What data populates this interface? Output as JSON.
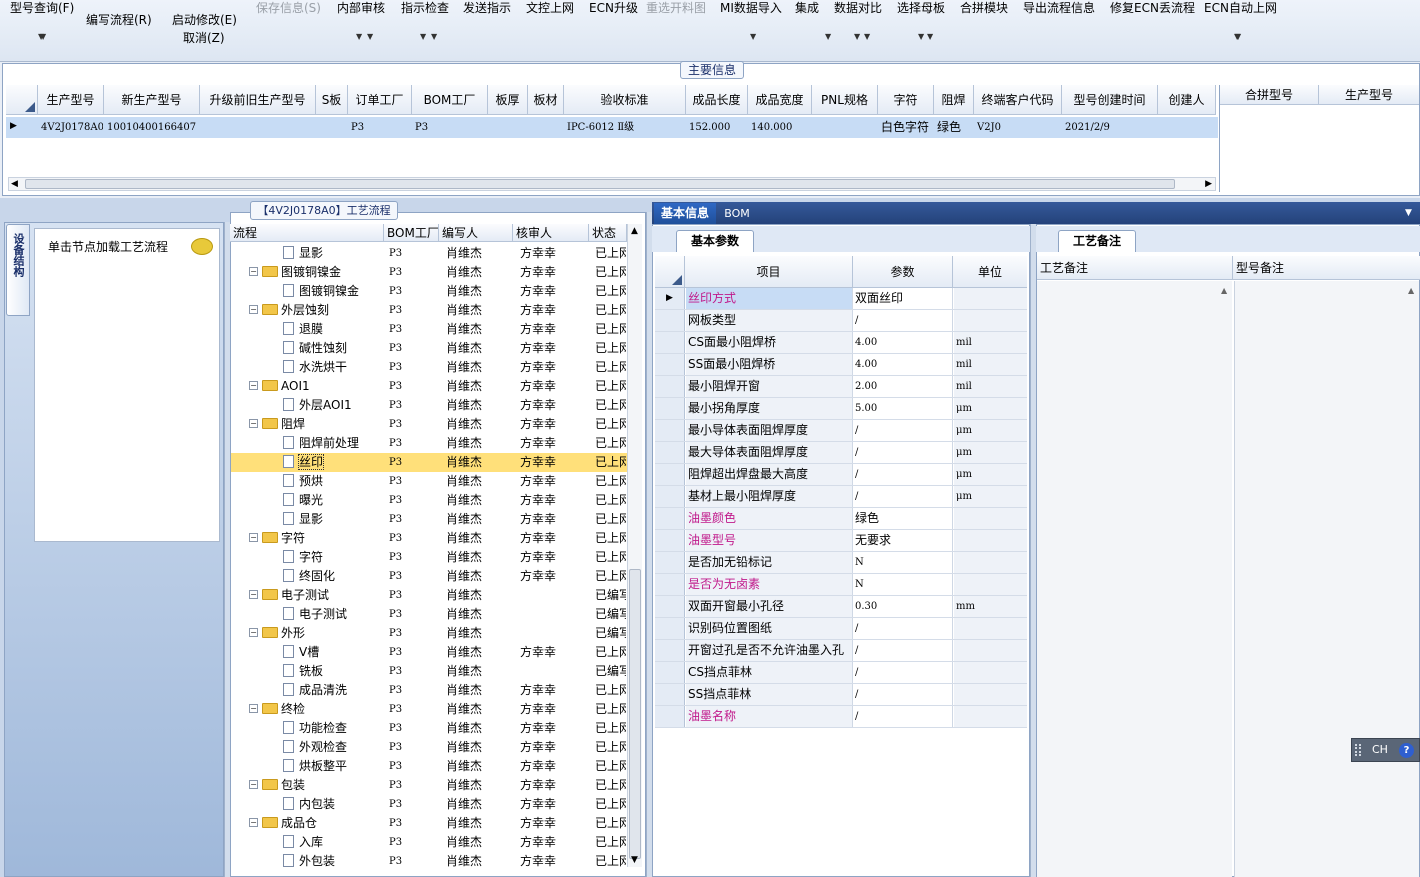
{
  "toolbar": {
    "items": [
      {
        "label": "型号查询(F)",
        "state": "enabled"
      },
      {
        "label": "编写流程(R)",
        "state": "enabled"
      },
      {
        "label": "启动修改(E)",
        "state": "enabled"
      },
      {
        "label": "取消(Z)",
        "state": "enabled"
      },
      {
        "label": "保存信息(S)",
        "state": "disabled"
      },
      {
        "label": "内部审核",
        "state": "enabled"
      },
      {
        "label": "指示检查",
        "state": "enabled"
      },
      {
        "label": "发送指示",
        "state": "enabled"
      },
      {
        "label": "文控上网",
        "state": "enabled"
      },
      {
        "label": "ECN升级",
        "state": "enabled"
      },
      {
        "label": "重选开料图",
        "state": "disabled"
      },
      {
        "label": "MI数据导入",
        "state": "enabled"
      },
      {
        "label": "集成",
        "state": "enabled"
      },
      {
        "label": "数据对比",
        "state": "enabled"
      },
      {
        "label": "选择母板",
        "state": "enabled"
      },
      {
        "label": "合拼模块",
        "state": "enabled"
      },
      {
        "label": "导出流程信息",
        "state": "enabled"
      },
      {
        "label": "修复ECN丢流程",
        "state": "enabled"
      },
      {
        "label": "ECN自动上网",
        "state": "enabled"
      }
    ],
    "dropdown_icon": "triangle-down-icon"
  },
  "main_info": {
    "title": "主要信息",
    "columns": [
      "生产型号",
      "新生产型号",
      "升级前旧生产型号",
      "S板",
      "订单工厂",
      "BOM工厂",
      "板厚",
      "板材",
      "验收标准",
      "成品长度",
      "成品宽度",
      "PNL规格",
      "字符",
      "阻焊",
      "终端客户代码",
      "型号创建时间",
      "创建人"
    ],
    "row": [
      "4V2J0178A0",
      "10010400166407",
      "",
      "",
      "P3",
      "P3",
      "",
      "",
      "IPC-6012 Ⅱ级",
      "152.000",
      "140.000",
      "",
      "白色字符",
      "绿色",
      "V2J0",
      "2021/2/9",
      ""
    ],
    "side_columns": [
      "合拼型号",
      "生产型号"
    ]
  },
  "left_panel": {
    "vertical_tab": "设备结构",
    "hint": "单击节点加载工艺流程"
  },
  "flow": {
    "title": "【4V2J0178A0】工艺流程",
    "columns": [
      "流程",
      "BOM工厂",
      "编写人",
      "核审人",
      "状态"
    ],
    "rows": [
      {
        "name": "显影",
        "folder": false,
        "bom": "P3",
        "writer": "肖维杰",
        "auditor": "方幸幸",
        "status": "已上网",
        "selected": false
      },
      {
        "name": "图镀铜镍金",
        "folder": true,
        "bom": "P3",
        "writer": "肖维杰",
        "auditor": "方幸幸",
        "status": "已上网",
        "selected": false
      },
      {
        "name": "图镀铜镍金",
        "folder": false,
        "bom": "P3",
        "writer": "肖维杰",
        "auditor": "方幸幸",
        "status": "已上网",
        "selected": false
      },
      {
        "name": "外层蚀刻",
        "folder": true,
        "bom": "P3",
        "writer": "肖维杰",
        "auditor": "方幸幸",
        "status": "已上网",
        "selected": false
      },
      {
        "name": "退膜",
        "folder": false,
        "bom": "P3",
        "writer": "肖维杰",
        "auditor": "方幸幸",
        "status": "已上网",
        "selected": false
      },
      {
        "name": "碱性蚀刻",
        "folder": false,
        "bom": "P3",
        "writer": "肖维杰",
        "auditor": "方幸幸",
        "status": "已上网",
        "selected": false
      },
      {
        "name": "水洗烘干",
        "folder": false,
        "bom": "P3",
        "writer": "肖维杰",
        "auditor": "方幸幸",
        "status": "已上网",
        "selected": false
      },
      {
        "name": "AOI1",
        "folder": true,
        "bom": "P3",
        "writer": "肖维杰",
        "auditor": "方幸幸",
        "status": "已上网",
        "selected": false
      },
      {
        "name": "外层AOI1",
        "folder": false,
        "bom": "P3",
        "writer": "肖维杰",
        "auditor": "方幸幸",
        "status": "已上网",
        "selected": false
      },
      {
        "name": "阻焊",
        "folder": true,
        "bom": "P3",
        "writer": "肖维杰",
        "auditor": "方幸幸",
        "status": "已上网",
        "selected": false
      },
      {
        "name": "阻焊前处理",
        "folder": false,
        "bom": "P3",
        "writer": "肖维杰",
        "auditor": "方幸幸",
        "status": "已上网",
        "selected": false
      },
      {
        "name": "丝印",
        "folder": false,
        "bom": "P3",
        "writer": "肖维杰",
        "auditor": "方幸幸",
        "status": "已上网",
        "selected": true
      },
      {
        "name": "预烘",
        "folder": false,
        "bom": "P3",
        "writer": "肖维杰",
        "auditor": "方幸幸",
        "status": "已上网",
        "selected": false
      },
      {
        "name": "曝光",
        "folder": false,
        "bom": "P3",
        "writer": "肖维杰",
        "auditor": "方幸幸",
        "status": "已上网",
        "selected": false
      },
      {
        "name": "显影",
        "folder": false,
        "bom": "P3",
        "writer": "肖维杰",
        "auditor": "方幸幸",
        "status": "已上网",
        "selected": false
      },
      {
        "name": "字符",
        "folder": true,
        "bom": "P3",
        "writer": "肖维杰",
        "auditor": "方幸幸",
        "status": "已上网",
        "selected": false
      },
      {
        "name": "字符",
        "folder": false,
        "bom": "P3",
        "writer": "肖维杰",
        "auditor": "方幸幸",
        "status": "已上网",
        "selected": false
      },
      {
        "name": "终固化",
        "folder": false,
        "bom": "P3",
        "writer": "肖维杰",
        "auditor": "方幸幸",
        "status": "已上网",
        "selected": false
      },
      {
        "name": "电子测试",
        "folder": true,
        "bom": "P3",
        "writer": "肖维杰",
        "auditor": "",
        "status": "已编写",
        "selected": false
      },
      {
        "name": "电子测试",
        "folder": false,
        "bom": "P3",
        "writer": "肖维杰",
        "auditor": "",
        "status": "已编写",
        "selected": false
      },
      {
        "name": "外形",
        "folder": true,
        "bom": "P3",
        "writer": "肖维杰",
        "auditor": "",
        "status": "已编写",
        "selected": false
      },
      {
        "name": "V槽",
        "folder": false,
        "bom": "P3",
        "writer": "肖维杰",
        "auditor": "方幸幸",
        "status": "已上网",
        "selected": false
      },
      {
        "name": "铣板",
        "folder": false,
        "bom": "P3",
        "writer": "肖维杰",
        "auditor": "",
        "status": "已编写",
        "selected": false
      },
      {
        "name": "成品清洗",
        "folder": false,
        "bom": "P3",
        "writer": "肖维杰",
        "auditor": "方幸幸",
        "status": "已上网",
        "selected": false
      },
      {
        "name": "终检",
        "folder": true,
        "bom": "P3",
        "writer": "肖维杰",
        "auditor": "方幸幸",
        "status": "已上网",
        "selected": false
      },
      {
        "name": "功能检查",
        "folder": false,
        "bom": "P3",
        "writer": "肖维杰",
        "auditor": "方幸幸",
        "status": "已上网",
        "selected": false
      },
      {
        "name": "外观检查",
        "folder": false,
        "bom": "P3",
        "writer": "肖维杰",
        "auditor": "方幸幸",
        "status": "已上网",
        "selected": false
      },
      {
        "name": "烘板整平",
        "folder": false,
        "bom": "P3",
        "writer": "肖维杰",
        "auditor": "方幸幸",
        "status": "已上网",
        "selected": false
      },
      {
        "name": "包装",
        "folder": true,
        "bom": "P3",
        "writer": "肖维杰",
        "auditor": "方幸幸",
        "status": "已上网",
        "selected": false
      },
      {
        "name": "内包装",
        "folder": false,
        "bom": "P3",
        "writer": "肖维杰",
        "auditor": "方幸幸",
        "status": "已上网",
        "selected": false
      },
      {
        "name": "成品仓",
        "folder": true,
        "bom": "P3",
        "writer": "肖维杰",
        "auditor": "方幸幸",
        "status": "已上网",
        "selected": false
      },
      {
        "name": "入库",
        "folder": false,
        "bom": "P3",
        "writer": "肖维杰",
        "auditor": "方幸幸",
        "status": "已上网",
        "selected": false
      },
      {
        "name": "外包装",
        "folder": false,
        "bom": "P3",
        "writer": "肖维杰",
        "auditor": "方幸幸",
        "status": "已上网",
        "selected": false
      }
    ]
  },
  "tabs": {
    "basic": "基本信息",
    "bom": "BOM"
  },
  "params": {
    "tab": "基本参数",
    "columns": [
      "项目",
      "参数",
      "单位"
    ],
    "rows": [
      {
        "item": "丝印方式",
        "value": "双面丝印",
        "unit": "",
        "highlight": true
      },
      {
        "item": "网板类型",
        "value": "/",
        "unit": "",
        "highlight": false
      },
      {
        "item": "CS面最小阻焊桥",
        "value": "4.00",
        "unit": "mil",
        "highlight": false
      },
      {
        "item": "SS面最小阻焊桥",
        "value": "4.00",
        "unit": "mil",
        "highlight": false
      },
      {
        "item": "最小阻焊开窗",
        "value": "2.00",
        "unit": "mil",
        "highlight": false
      },
      {
        "item": "最小拐角厚度",
        "value": "5.00",
        "unit": "μm",
        "highlight": false
      },
      {
        "item": "最小导体表面阻焊厚度",
        "value": "/",
        "unit": "μm",
        "highlight": false
      },
      {
        "item": "最大导体表面阻焊厚度",
        "value": "/",
        "unit": "μm",
        "highlight": false
      },
      {
        "item": "阻焊超出焊盘最大高度",
        "value": "/",
        "unit": "μm",
        "highlight": false
      },
      {
        "item": "基材上最小阻焊厚度",
        "value": "/",
        "unit": "μm",
        "highlight": false
      },
      {
        "item": "油墨颜色",
        "value": "绿色",
        "unit": "",
        "highlight": true
      },
      {
        "item": "油墨型号",
        "value": "无要求",
        "unit": "",
        "highlight": true
      },
      {
        "item": "是否加无铅标记",
        "value": "N",
        "unit": "",
        "highlight": false
      },
      {
        "item": "是否为无卤素",
        "value": "N",
        "unit": "",
        "highlight": true
      },
      {
        "item": "双面开窗最小孔径",
        "value": "0.30",
        "unit": "mm",
        "highlight": false
      },
      {
        "item": "识别码位置图纸",
        "value": "/",
        "unit": "",
        "highlight": false
      },
      {
        "item": "开窗过孔是否不允许油墨入孔",
        "value": "/",
        "unit": "",
        "highlight": false
      },
      {
        "item": "CS挡点菲林",
        "value": "/",
        "unit": "",
        "highlight": false
      },
      {
        "item": "SS挡点菲林",
        "value": "/",
        "unit": "",
        "highlight": false
      },
      {
        "item": "油墨名称",
        "value": "/",
        "unit": "",
        "highlight": true
      }
    ]
  },
  "notes": {
    "tab": "工艺备注",
    "col1": "工艺备注",
    "col2": "型号备注"
  },
  "ime": {
    "label": "CH",
    "help": "?"
  },
  "colors": {
    "highlight_text": "#c0188a",
    "selected_row": "#ffe07a",
    "row_select": "#c7dcf5",
    "tab_active": "#1f4f9a"
  }
}
